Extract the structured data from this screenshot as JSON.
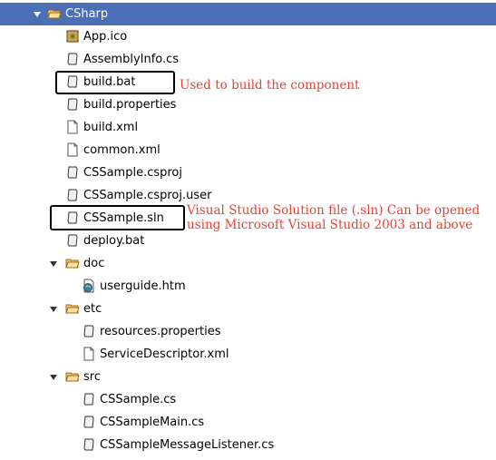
{
  "tree": {
    "root": {
      "label": "CSharp",
      "icon": "folder-open-icon",
      "expanded": true,
      "selected": true
    },
    "items": [
      {
        "label": "App.ico",
        "icon": "image-file-icon"
      },
      {
        "label": "AssemblyInfo.cs",
        "icon": "script-file-icon"
      },
      {
        "label": "build.bat",
        "icon": "script-file-icon"
      },
      {
        "label": "build.properties",
        "icon": "script-file-icon"
      },
      {
        "label": "build.xml",
        "icon": "document-file-icon"
      },
      {
        "label": "common.xml",
        "icon": "document-file-icon"
      },
      {
        "label": "CSSample.csproj",
        "icon": "script-file-icon"
      },
      {
        "label": "CSSample.csproj.user",
        "icon": "script-file-icon"
      },
      {
        "label": "CSSample.sln",
        "icon": "script-file-icon"
      },
      {
        "label": "deploy.bat",
        "icon": "script-file-icon"
      },
      {
        "label": "doc",
        "icon": "folder-open-icon",
        "expanded": true
      },
      {
        "label": "userguide.htm",
        "icon": "html-file-icon"
      },
      {
        "label": "etc",
        "icon": "folder-open-icon",
        "expanded": true
      },
      {
        "label": "resources.properties",
        "icon": "script-file-icon"
      },
      {
        "label": "ServiceDescriptor.xml",
        "icon": "document-file-icon"
      },
      {
        "label": "src",
        "icon": "folder-open-icon",
        "expanded": true
      },
      {
        "label": "CSSample.cs",
        "icon": "script-file-icon"
      },
      {
        "label": "CSSampleMain.cs",
        "icon": "script-file-icon"
      },
      {
        "label": "CSSampleMessageListener.cs",
        "icon": "script-file-icon"
      }
    ]
  },
  "annotations": {
    "build_bat": "Used to build the component",
    "sln_line1": "Visual Studio Solution file (.sln) Can be opened",
    "sln_line2": "using Microsoft Visual Studio 2003 and above"
  },
  "colors": {
    "selection": "#4a6fb5",
    "annotation_text": "#e0443a",
    "folder": "#f5c46a"
  }
}
